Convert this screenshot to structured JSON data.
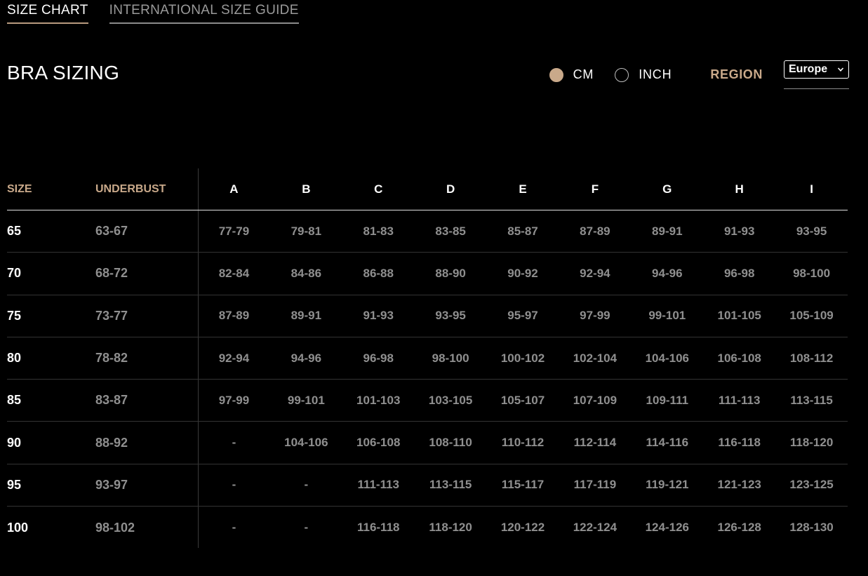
{
  "tabs": [
    {
      "label": "SIZE CHART",
      "active": true
    },
    {
      "label": "INTERNATIONAL SIZE GUIDE",
      "active": false
    }
  ],
  "title": "BRA SIZING",
  "units": {
    "cm_label": "CM",
    "inch_label": "INCH",
    "selected": "CM"
  },
  "region": {
    "label": "REGION",
    "selected": "Europe"
  },
  "colors": {
    "accent": "#c9a98a",
    "muted_text": "#8f8f8f",
    "background": "#000000"
  },
  "icons": {
    "dropdown": "chevron-down-icon"
  },
  "table": {
    "headers": {
      "size": "SIZE",
      "underbust": "UNDERBUST",
      "cups": [
        "A",
        "B",
        "C",
        "D",
        "E",
        "F",
        "G",
        "H",
        "I"
      ]
    },
    "rows": [
      {
        "size": "65",
        "underbust": "63-67",
        "values": [
          "77-79",
          "79-81",
          "81-83",
          "83-85",
          "85-87",
          "87-89",
          "89-91",
          "91-93",
          "93-95"
        ]
      },
      {
        "size": "70",
        "underbust": "68-72",
        "values": [
          "82-84",
          "84-86",
          "86-88",
          "88-90",
          "90-92",
          "92-94",
          "94-96",
          "96-98",
          "98-100"
        ]
      },
      {
        "size": "75",
        "underbust": "73-77",
        "values": [
          "87-89",
          "89-91",
          "91-93",
          "93-95",
          "95-97",
          "97-99",
          "99-101",
          "101-105",
          "105-109"
        ]
      },
      {
        "size": "80",
        "underbust": "78-82",
        "values": [
          "92-94",
          "94-96",
          "96-98",
          "98-100",
          "100-102",
          "102-104",
          "104-106",
          "106-108",
          "108-112"
        ]
      },
      {
        "size": "85",
        "underbust": "83-87",
        "values": [
          "97-99",
          "99-101",
          "101-103",
          "103-105",
          "105-107",
          "107-109",
          "109-111",
          "111-113",
          "113-115"
        ]
      },
      {
        "size": "90",
        "underbust": "88-92",
        "values": [
          "-",
          "104-106",
          "106-108",
          "108-110",
          "110-112",
          "112-114",
          "114-116",
          "116-118",
          "118-120"
        ]
      },
      {
        "size": "95",
        "underbust": "93-97",
        "values": [
          "-",
          "-",
          "111-113",
          "113-115",
          "115-117",
          "117-119",
          "119-121",
          "121-123",
          "123-125"
        ]
      },
      {
        "size": "100",
        "underbust": "98-102",
        "values": [
          "-",
          "-",
          "116-118",
          "118-120",
          "120-122",
          "122-124",
          "124-126",
          "126-128",
          "128-130"
        ]
      }
    ]
  }
}
